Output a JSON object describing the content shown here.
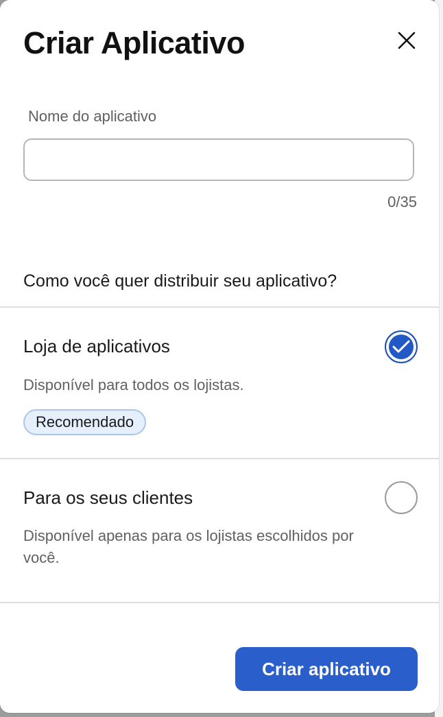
{
  "dialog": {
    "title": "Criar Aplicativo",
    "close_icon": "close-icon"
  },
  "app_name_field": {
    "label": "Nome do aplicativo",
    "value": "",
    "placeholder": "",
    "counter": "0/35"
  },
  "distribution": {
    "question": "Como você quer distribuir seu aplicativo?",
    "options": [
      {
        "title": "Loja de aplicativos",
        "description": "Disponível para todos os lojistas.",
        "badge": "Recomendado",
        "selected": true
      },
      {
        "title": "Para os seus clientes",
        "description": "Disponível apenas para os lojistas escolhidos por você.",
        "selected": false
      }
    ]
  },
  "footer": {
    "create_button_label": "Criar aplicativo"
  },
  "colors": {
    "primary": "#2a5fcb",
    "badge_bg": "#e6f0fc",
    "badge_border": "#a8c6ea"
  }
}
